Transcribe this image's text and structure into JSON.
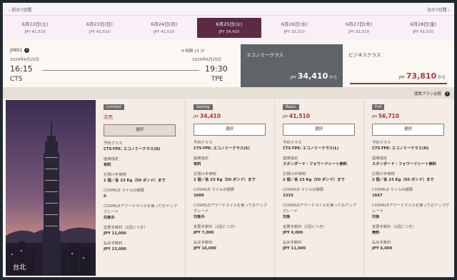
{
  "nav": {
    "prev": "前の7日間",
    "next": "次の7日間"
  },
  "dates": [
    {
      "date": "6月22日(土)",
      "price": "JPY 41,510",
      "selected": false
    },
    {
      "date": "6月23日(日)",
      "price": "JPY 41,510",
      "selected": false
    },
    {
      "date": "6月24日(月)",
      "price": "JPY 41,510",
      "selected": false
    },
    {
      "date": "6月25日(火)",
      "price": "JPY 34,410",
      "selected": true
    },
    {
      "date": "6月26日(水)",
      "price": "JPY 32,510",
      "selected": false
    },
    {
      "date": "6月27日(木)",
      "price": "JPY 32,510",
      "selected": false
    },
    {
      "date": "6月28日(金)",
      "price": "JPY 41,510",
      "selected": false
    }
  ],
  "flight": {
    "number": "JX851",
    "duration": "4 時間 15 分",
    "dep": {
      "date": "2024年6月25日",
      "time": "16:15",
      "code": "CTS"
    },
    "arr": {
      "date": "2024年6月25日",
      "time": "19:30",
      "code": "TPE"
    }
  },
  "cabins": {
    "economy": {
      "label": "エコノミークラス",
      "currency": "JPY",
      "price": "34,410",
      "suffix": "から"
    },
    "business": {
      "label": "ビジネスクラス",
      "currency": "JPY",
      "price": "73,810",
      "suffix": "から"
    }
  },
  "compare_label": "運賃プラン比較",
  "photo_label": "台北",
  "labels": {
    "select": "選択",
    "booking_class": "予約クラス",
    "seat": "座席指定",
    "baggage": "お預け手荷物",
    "miles": "COSMILE マイルの積算",
    "upgrade": "COSMILEアワードマイルを使ってのアップグレード",
    "change_fee": "変更手数料（1回につき）",
    "refund_fee": "払戻手数料"
  },
  "plans": [
    {
      "name": "Limited",
      "price": "",
      "soldout": "完売",
      "booking_class": "CTS-TPE: エコノミークラス(Q)",
      "seat": "有料",
      "baggage": "1 個／各 23 Kg（50 ポンド）まで",
      "miles": "0",
      "upgrade": "対象外",
      "change_fee": "JPY 11,000",
      "refund_fee": "JPY 23,000"
    },
    {
      "name": "Saving",
      "price": "34,410",
      "soldout": "",
      "booking_class": "CTS-TPE: エコノミークラス(S)",
      "seat": "有料",
      "baggage": "1 個／各 23 Kg（50 ポンド）まで",
      "miles": "1000",
      "upgrade": "対象外",
      "change_fee": "JPY 7,000",
      "refund_fee": "JPY 16,000"
    },
    {
      "name": "Basic",
      "price": "41,510",
      "soldout": "",
      "booking_class": "CTS-TPE: エコノミークラス(L)",
      "seat": "スタンダード・フォワードシート無料",
      "baggage": "2 個／各 23 Kg（50 ポンド）まで",
      "miles": "1333",
      "upgrade": "対象",
      "change_fee": "JPY 4,000",
      "refund_fee": "JPY 11,000"
    },
    {
      "name": "Full",
      "price": "56,710",
      "soldout": "",
      "booking_class": "CTS-TPE: エコノミークラス(H)",
      "seat": "スタンダード・フォワードシート無料",
      "baggage": "2 個／各 23 Kg（50 ポンド）まで",
      "miles": "1667",
      "upgrade": "対象",
      "change_fee": "無料",
      "refund_fee": "JPY 6,000"
    }
  ]
}
